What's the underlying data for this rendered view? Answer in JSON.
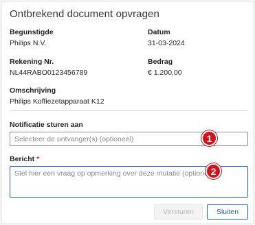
{
  "dialog": {
    "title": "Ontbrekend document opvragen"
  },
  "details": {
    "beneficiary": {
      "label": "Begunstigde",
      "value": "Philips N.V."
    },
    "date": {
      "label": "Datum",
      "value": "31-03-2024"
    },
    "account": {
      "label": "Rekening Nr.",
      "value": "NL44RABO0123456789"
    },
    "amount": {
      "label": "Bedrag",
      "value": "€ 1.200,00"
    },
    "description": {
      "label": "Omschrijving",
      "value": "Philips Koffiezetapparaat K12"
    }
  },
  "notify": {
    "label": "Notificatie sturen aan",
    "placeholder": "Selecteer de ontvanger(s) (optioneel)"
  },
  "message": {
    "label": "Bericht",
    "required_marker": "*",
    "placeholder": "Stel hier een vraag op opmerking over deze mutatie (optioneel)"
  },
  "badges": [
    "1",
    "2"
  ],
  "badge_color": "#d0141b",
  "accent_color": "#1f5fbf",
  "actions": {
    "send_label": "Versturen",
    "close_label": "Sluiten"
  }
}
